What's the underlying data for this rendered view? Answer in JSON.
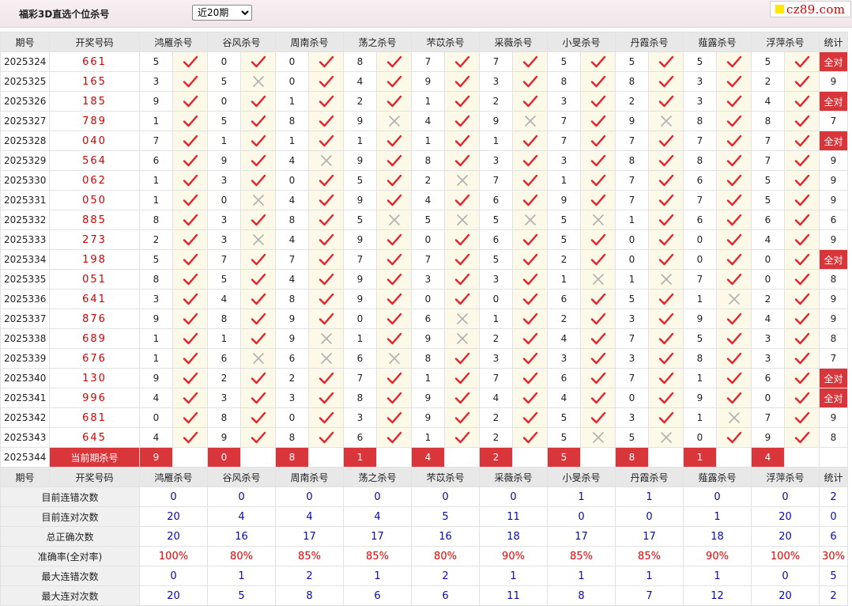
{
  "header": {
    "title": "福彩3D直选个位杀号",
    "period_option": "近20期",
    "logo_text": "cz89.com"
  },
  "columns": {
    "issue": "期号",
    "draw": "开奖号码",
    "experts": [
      "鸿雁杀号",
      "谷风杀号",
      "周南杀号",
      "荡之杀号",
      "芣苡杀号",
      "采薇杀号",
      "小旻杀号",
      "丹霞杀号",
      "薤露杀号",
      "浮萍杀号"
    ],
    "stat": "统计"
  },
  "rows": [
    {
      "issue": "2025324",
      "draw": "661",
      "kills": [
        5,
        0,
        0,
        8,
        7,
        7,
        5,
        5,
        5,
        5
      ],
      "ok": [
        1,
        1,
        1,
        1,
        1,
        1,
        1,
        1,
        1,
        1
      ],
      "stat": "全对"
    },
    {
      "issue": "2025325",
      "draw": "165",
      "kills": [
        3,
        5,
        0,
        4,
        9,
        3,
        8,
        8,
        3,
        2
      ],
      "ok": [
        1,
        0,
        1,
        1,
        1,
        1,
        1,
        1,
        1,
        1
      ],
      "stat": "9"
    },
    {
      "issue": "2025326",
      "draw": "185",
      "kills": [
        9,
        0,
        1,
        2,
        1,
        2,
        3,
        2,
        3,
        4
      ],
      "ok": [
        1,
        1,
        1,
        1,
        1,
        1,
        1,
        1,
        1,
        1
      ],
      "stat": "全对"
    },
    {
      "issue": "2025327",
      "draw": "789",
      "kills": [
        1,
        5,
        8,
        9,
        4,
        9,
        7,
        9,
        8,
        8
      ],
      "ok": [
        1,
        1,
        1,
        0,
        1,
        0,
        1,
        0,
        1,
        1
      ],
      "stat": "7"
    },
    {
      "issue": "2025328",
      "draw": "040",
      "kills": [
        7,
        1,
        1,
        1,
        1,
        1,
        7,
        7,
        7,
        7
      ],
      "ok": [
        1,
        1,
        1,
        1,
        1,
        1,
        1,
        1,
        1,
        1
      ],
      "stat": "全对"
    },
    {
      "issue": "2025329",
      "draw": "564",
      "kills": [
        6,
        9,
        4,
        9,
        8,
        3,
        3,
        8,
        8,
        7
      ],
      "ok": [
        1,
        1,
        0,
        1,
        1,
        1,
        1,
        1,
        1,
        1
      ],
      "stat": "9"
    },
    {
      "issue": "2025330",
      "draw": "062",
      "kills": [
        1,
        3,
        0,
        5,
        2,
        7,
        1,
        7,
        6,
        5
      ],
      "ok": [
        1,
        1,
        1,
        1,
        0,
        1,
        1,
        1,
        1,
        1
      ],
      "stat": "9"
    },
    {
      "issue": "2025331",
      "draw": "050",
      "kills": [
        1,
        0,
        4,
        9,
        4,
        6,
        9,
        7,
        7,
        5
      ],
      "ok": [
        1,
        0,
        1,
        1,
        1,
        1,
        1,
        1,
        1,
        1
      ],
      "stat": "9"
    },
    {
      "issue": "2025332",
      "draw": "885",
      "kills": [
        8,
        3,
        8,
        5,
        5,
        5,
        5,
        1,
        6,
        6
      ],
      "ok": [
        1,
        1,
        1,
        0,
        0,
        0,
        0,
        1,
        1,
        1
      ],
      "stat": "6"
    },
    {
      "issue": "2025333",
      "draw": "273",
      "kills": [
        2,
        3,
        4,
        9,
        0,
        6,
        5,
        0,
        0,
        4
      ],
      "ok": [
        1,
        0,
        1,
        1,
        1,
        1,
        1,
        1,
        1,
        1
      ],
      "stat": "9"
    },
    {
      "issue": "2025334",
      "draw": "198",
      "kills": [
        5,
        7,
        7,
        7,
        7,
        5,
        2,
        0,
        0,
        0
      ],
      "ok": [
        1,
        1,
        1,
        1,
        1,
        1,
        1,
        1,
        1,
        1
      ],
      "stat": "全对"
    },
    {
      "issue": "2025335",
      "draw": "051",
      "kills": [
        8,
        5,
        4,
        9,
        3,
        3,
        1,
        1,
        7,
        0
      ],
      "ok": [
        1,
        1,
        1,
        1,
        1,
        1,
        0,
        0,
        1,
        1
      ],
      "stat": "8"
    },
    {
      "issue": "2025336",
      "draw": "641",
      "kills": [
        3,
        4,
        8,
        9,
        0,
        0,
        6,
        5,
        1,
        2
      ],
      "ok": [
        1,
        1,
        1,
        1,
        1,
        1,
        1,
        1,
        0,
        1
      ],
      "stat": "9"
    },
    {
      "issue": "2025337",
      "draw": "876",
      "kills": [
        9,
        8,
        9,
        0,
        6,
        1,
        2,
        3,
        9,
        4
      ],
      "ok": [
        1,
        1,
        1,
        1,
        0,
        1,
        1,
        1,
        1,
        1
      ],
      "stat": "9"
    },
    {
      "issue": "2025338",
      "draw": "689",
      "kills": [
        1,
        1,
        9,
        1,
        9,
        2,
        4,
        7,
        5,
        3
      ],
      "ok": [
        1,
        1,
        0,
        1,
        0,
        1,
        1,
        1,
        1,
        1
      ],
      "stat": "8"
    },
    {
      "issue": "2025339",
      "draw": "676",
      "kills": [
        1,
        6,
        6,
        6,
        8,
        3,
        3,
        3,
        8,
        3
      ],
      "ok": [
        1,
        0,
        0,
        0,
        1,
        1,
        1,
        1,
        1,
        1
      ],
      "stat": "7"
    },
    {
      "issue": "2025340",
      "draw": "130",
      "kills": [
        9,
        2,
        2,
        7,
        1,
        7,
        6,
        7,
        1,
        6
      ],
      "ok": [
        1,
        1,
        1,
        1,
        1,
        1,
        1,
        1,
        1,
        1
      ],
      "stat": "全对"
    },
    {
      "issue": "2025341",
      "draw": "996",
      "kills": [
        4,
        3,
        3,
        8,
        9,
        4,
        4,
        0,
        9,
        0
      ],
      "ok": [
        1,
        1,
        1,
        1,
        1,
        1,
        1,
        1,
        1,
        1
      ],
      "stat": "全对"
    },
    {
      "issue": "2025342",
      "draw": "681",
      "kills": [
        0,
        8,
        0,
        3,
        9,
        2,
        5,
        3,
        1,
        7
      ],
      "ok": [
        1,
        1,
        1,
        1,
        1,
        1,
        1,
        1,
        0,
        1
      ],
      "stat": "9"
    },
    {
      "issue": "2025343",
      "draw": "645",
      "kills": [
        4,
        9,
        8,
        6,
        1,
        2,
        5,
        5,
        0,
        9
      ],
      "ok": [
        1,
        1,
        1,
        1,
        1,
        1,
        0,
        0,
        1,
        1
      ],
      "stat": "8"
    }
  ],
  "current": {
    "issue": "2025344",
    "label": "当前期杀号",
    "kills": [
      "9",
      "0",
      "8",
      "1",
      "4",
      "2",
      "5",
      "8",
      "1",
      "4"
    ]
  },
  "summary": [
    {
      "label": "目前连错次数",
      "values": [
        "0",
        "0",
        "0",
        "0",
        "0",
        "0",
        "1",
        "1",
        "0",
        "0"
      ],
      "stat": "2",
      "red": false
    },
    {
      "label": "目前连对次数",
      "values": [
        "20",
        "4",
        "4",
        "4",
        "5",
        "11",
        "0",
        "0",
        "1",
        "20"
      ],
      "stat": "0",
      "red": false
    },
    {
      "label": "总正确次数",
      "values": [
        "20",
        "16",
        "17",
        "17",
        "16",
        "18",
        "17",
        "17",
        "18",
        "20"
      ],
      "stat": "6",
      "red": false
    },
    {
      "label": "准确率(全对率)",
      "values": [
        "100%",
        "80%",
        "85%",
        "85%",
        "80%",
        "90%",
        "85%",
        "85%",
        "90%",
        "100%"
      ],
      "stat": "30%",
      "red": true
    },
    {
      "label": "最大连错次数",
      "values": [
        "0",
        "1",
        "2",
        "1",
        "2",
        "1",
        "1",
        "1",
        "1",
        "0"
      ],
      "stat": "5",
      "red": false
    },
    {
      "label": "最大连对次数",
      "values": [
        "20",
        "5",
        "8",
        "6",
        "6",
        "11",
        "8",
        "7",
        "12",
        "20"
      ],
      "stat": "2",
      "red": false
    }
  ],
  "icons": {
    "correct": "check-icon",
    "wrong": "cross-icon"
  },
  "colors": {
    "accent_red": "#d8363a",
    "check_red": "#e8202a",
    "cross_gray": "#b0b0b0",
    "summary_blue": "#0a0aa8",
    "draw_red": "#d40000"
  }
}
